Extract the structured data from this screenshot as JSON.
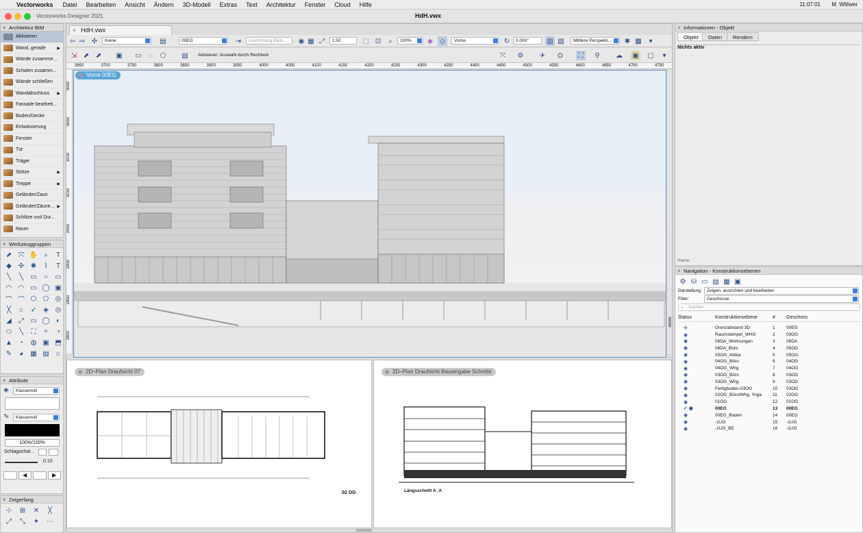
{
  "menubar": {
    "app": "Vectorworks",
    "items": [
      "Datei",
      "Bearbeiten",
      "Ansicht",
      "Ändern",
      "3D-Modell",
      "Extras",
      "Text",
      "Architektur",
      "Fenster",
      "Cloud",
      "Hilfe"
    ],
    "clock": "11:07:01",
    "user": "M. Wittwer"
  },
  "window": {
    "app_title": "Vectorworks Designer 2021",
    "doc_title": "HdH.vwx",
    "tab": "HdH.vwx"
  },
  "left_panel": {
    "title": "Architektur BIM",
    "active": "Aktivieren",
    "tools": [
      "Wand, gerade",
      "Wände zusamme...",
      "Schalen zusamm...",
      "Wände schließen",
      "Wandabschluss",
      "Fassade bearbeit...",
      "Boden/Decke",
      "Entwässerung",
      "Fenster",
      "Tür",
      "Träger",
      "Stütze",
      "Treppe",
      "Geländer/Zaun",
      "Geländer/Zäune...",
      "Schlitze und Dur...",
      "Raum"
    ],
    "groups_title": "Werkzeuggruppen"
  },
  "attributes": {
    "title": "Attribute",
    "fill_style": "Klassenstil",
    "pen_style": "Klassenstil",
    "opacity": "100%/100%",
    "shadow": "Schlagschat...",
    "line_weight": "0.10"
  },
  "snap": {
    "title": "Zeigerfang"
  },
  "toolbar": {
    "class": "Keine",
    "layer": "00EG",
    "align": "Ausrichtung Bilds...",
    "scale": "1:50",
    "zoom": "100%",
    "view": "Vorne",
    "angle": "0.000°",
    "projection": "Mittlere Perspekti...",
    "mode_hint": "Aktivieren: Auswahl durch Rechteck"
  },
  "ruler": {
    "h": [
      "3650",
      "3700",
      "3750",
      "3800",
      "3850",
      "3900",
      "3950",
      "4000",
      "4050",
      "4100",
      "4150",
      "4200",
      "4250",
      "4300",
      "4350",
      "4400",
      "4450",
      "4500",
      "4550",
      "4600",
      "4650",
      "4700",
      "4750"
    ],
    "v": [
      "3000",
      "3050",
      "3100",
      "3150",
      "2950",
      "2900",
      "2850",
      "2800"
    ]
  },
  "viewports": {
    "main": "Vorne  00EG",
    "plan": "2D–Plan Draufsicht  07",
    "section": "2D–Plan Draufsicht  Baueingabe Schnitte",
    "plan_caption": "02 OG",
    "section_caption": "Längsschnitt A_A"
  },
  "info_panel": {
    "title": "Informationen - Objekt",
    "tabs": [
      "Objekt",
      "Daten",
      "Rendern"
    ],
    "status": "Nichts aktiv",
    "name_label": "Name:"
  },
  "nav_panel": {
    "title": "Navigation - Konstruktionsebenen",
    "display_label": "Darstellung:",
    "display_value": "Zeigen, ausrichten und bearbeiten",
    "filter_label": "Filter:",
    "filter_value": "Geschosse",
    "search_placeholder": "Suchen",
    "headers": [
      "Status",
      "Konstruktionsebene",
      "#",
      "Geschoss"
    ],
    "rows": [
      [
        "Grenzabstand 3D",
        "1",
        "00EG"
      ],
      [
        "Raumstempel_WHG",
        "2",
        "03OG"
      ],
      [
        "06DA_Wohnungen",
        "3",
        "06DA"
      ],
      [
        "06DA_Büro",
        "4",
        "05OG"
      ],
      [
        "05OG_Attika",
        "5",
        "05OG"
      ],
      [
        "04OG_Büro",
        "6",
        "04OG"
      ],
      [
        "04OG_Whg",
        "7",
        "04OG"
      ],
      [
        "03OG_Büro",
        "8",
        "03OG"
      ],
      [
        "03OG_Whg.",
        "9",
        "03OG"
      ],
      [
        "Fertigboden-03OG",
        "10",
        "03OG"
      ],
      [
        "02OG_Büro/Whg. Yoga",
        "11",
        "02OG"
      ],
      [
        "01OG",
        "12",
        "01OG"
      ],
      [
        "00EG",
        "13",
        "00EG"
      ],
      [
        "00EG_Boden",
        "14",
        "00EG"
      ],
      [
        "-1UG",
        "15",
        "-1UG"
      ],
      [
        "-1UG_BE",
        "16",
        "-1UG"
      ]
    ],
    "active_row": 12
  }
}
